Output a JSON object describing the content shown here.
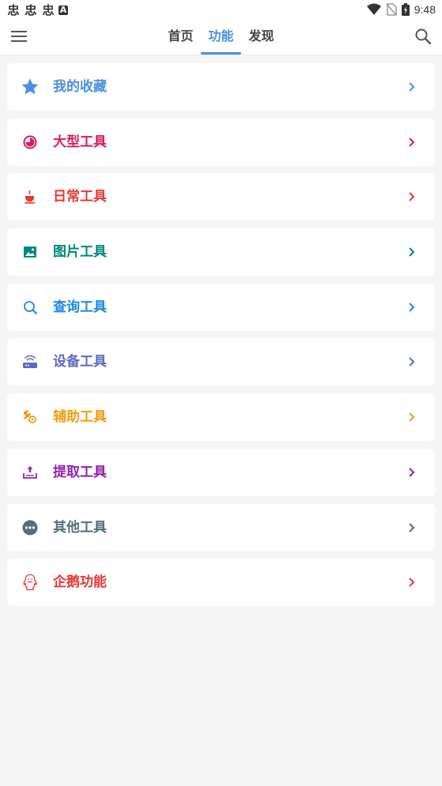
{
  "status_bar": {
    "left_glyphs": [
      "忠",
      "忠",
      "忠",
      "A"
    ],
    "time": "9:48"
  },
  "header": {
    "tabs": [
      {
        "label": "首页"
      },
      {
        "label": "功能"
      },
      {
        "label": "发现"
      }
    ],
    "active_tab": 1
  },
  "categories": [
    {
      "label": "我的收藏",
      "color": "#4a90e2",
      "icon": "star-icon"
    },
    {
      "label": "大型工具",
      "color": "#d81b60",
      "icon": "gauge-icon"
    },
    {
      "label": "日常工具",
      "color": "#e53935",
      "icon": "cup-icon"
    },
    {
      "label": "图片工具",
      "color": "#00897b",
      "icon": "image-icon"
    },
    {
      "label": "查询工具",
      "color": "#1e88e5",
      "icon": "search-icon"
    },
    {
      "label": "设备工具",
      "color": "#5c6bc0",
      "icon": "router-icon"
    },
    {
      "label": "辅助工具",
      "color": "#f39c12",
      "icon": "tools-icon"
    },
    {
      "label": "提取工具",
      "color": "#8e24aa",
      "icon": "extract-icon"
    },
    {
      "label": "其他工具",
      "color": "#546e7a",
      "icon": "more-icon"
    },
    {
      "label": "企鹅功能",
      "color": "#e53935",
      "icon": "penguin-icon"
    }
  ]
}
